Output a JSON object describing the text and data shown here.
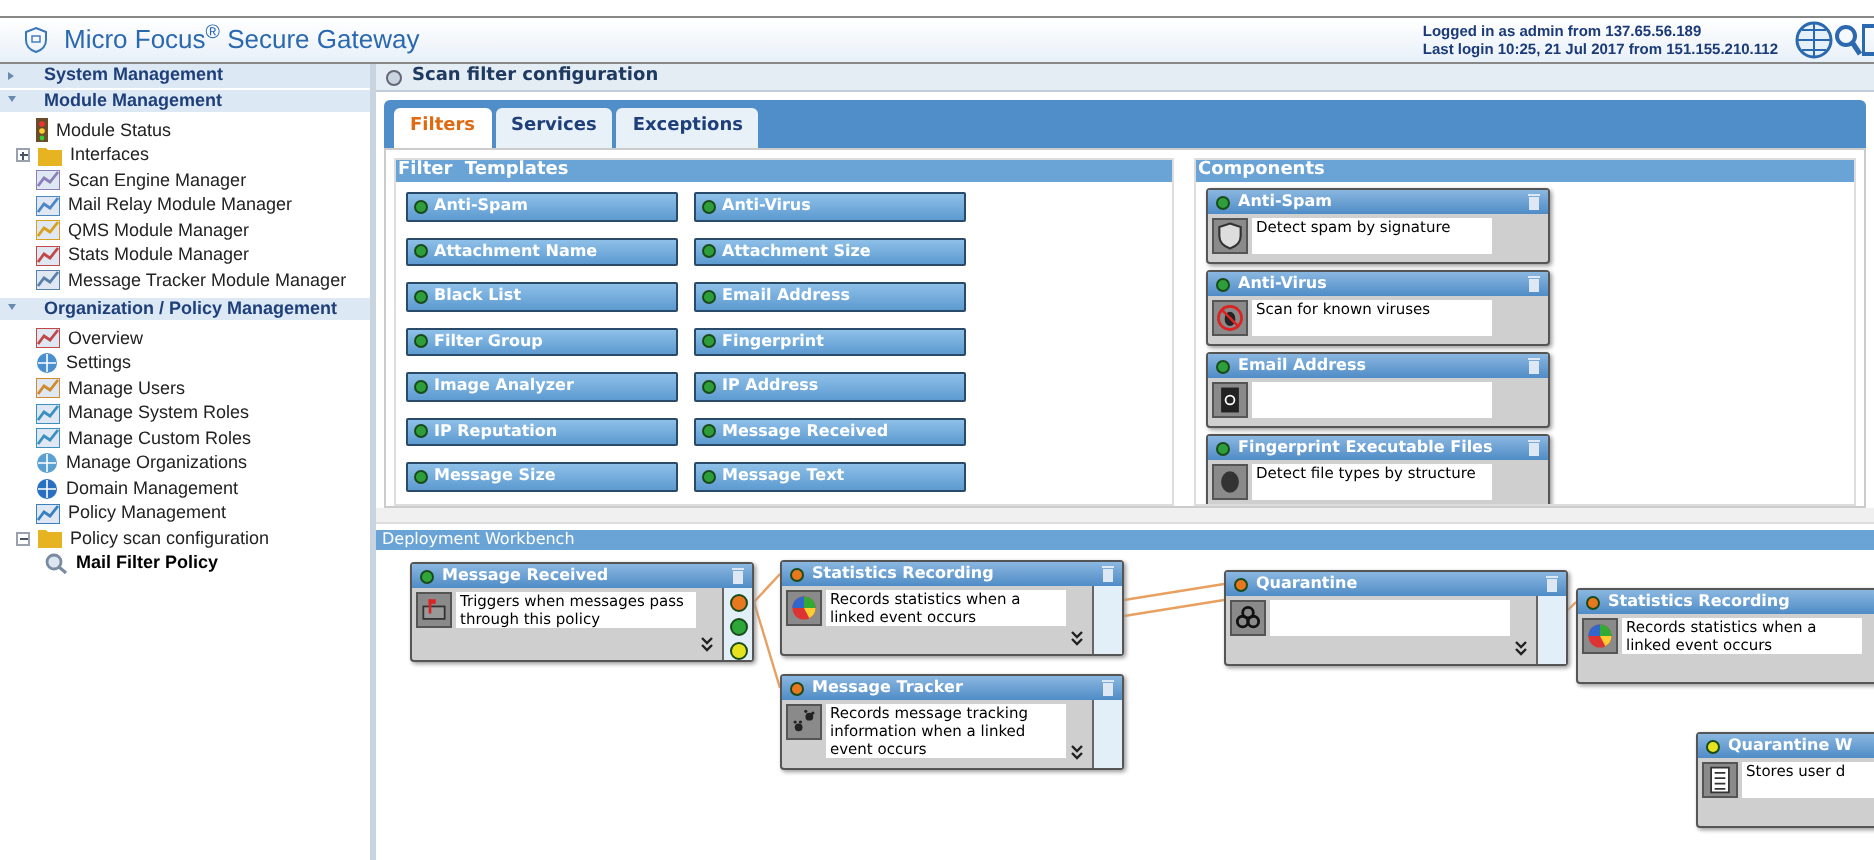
{
  "header": {
    "title": "Micro Focus$^{®}$ Secure Gateway",
    "login_line": "Logged in as admin from 137.65.56.189",
    "last_login_line": "Last login 10:25, 21 Jul 2017 from 151.155.210.112"
  },
  "sidebar": {
    "sections": [
      {
        "title": "System Management",
        "expanded": false
      },
      {
        "title": "Module Management",
        "expanded": true,
        "items": [
          {
            "label": "Module Status",
            "selected": false
          },
          {
            "label": "Interfaces",
            "selected": false,
            "expanded": false
          },
          {
            "label": "Scan Engine Manager",
            "selected": false
          },
          {
            "label": "Mail Relay Module Manager",
            "selected": false
          },
          {
            "label": "QMS Module Manager",
            "selected": false
          },
          {
            "label": "Stats Module Manager",
            "selected": false
          },
          {
            "label": "Message Tracker Module Manager",
            "selected": false
          }
        ]
      },
      {
        "title": "Organization / Policy Management",
        "expanded": true,
        "items": [
          {
            "label": "Overview",
            "selected": false
          },
          {
            "label": "Settings",
            "selected": false
          },
          {
            "label": "Manage Users",
            "selected": false
          },
          {
            "label": "Manage System Roles",
            "selected": false
          },
          {
            "label": "Manage Custom Roles",
            "selected": false
          },
          {
            "label": "Manage Organizations",
            "selected": false
          },
          {
            "label": "Domain Management",
            "selected": false
          },
          {
            "label": "Policy Management",
            "selected": false
          },
          {
            "label": "Policy scan configuration",
            "selected": false,
            "expanded": true,
            "children": [
              {
                "label": "Mail Filter Policy",
                "selected": true
              }
            ]
          }
        ]
      }
    ]
  },
  "page_title": "Scan filter configuration",
  "tabs": [
    {
      "label": "Filters",
      "selected": true
    },
    {
      "label": "Services",
      "selected": false
    },
    {
      "label": "Exceptions",
      "selected": false
    }
  ],
  "filter_templates": {
    "title": "Filter  Templates",
    "items": [
      {
        "label": "Anti-Spam",
        "color": "#2e9e3a"
      },
      {
        "label": "Anti-Virus",
        "color": "#2e9e3a"
      },
      {
        "label": "Attachment Name",
        "color": "#2e9e3a"
      },
      {
        "label": "Attachment Size",
        "color": "#2e9e3a"
      },
      {
        "label": "Black List",
        "color": "#2e9e3a"
      },
      {
        "label": "Email Address",
        "color": "#2e9e3a"
      },
      {
        "label": "Filter Group",
        "color": "#2e9e3a"
      },
      {
        "label": "Fingerprint",
        "color": "#2e9e3a"
      },
      {
        "label": "Image Analyzer",
        "color": "#2e9e3a"
      },
      {
        "label": "IP Address",
        "color": "#2e9e3a"
      },
      {
        "label": "IP Reputation",
        "color": "#2e9e3a"
      },
      {
        "label": "Message Received",
        "color": "#2e9e3a"
      },
      {
        "label": "Message Size",
        "color": "#2e9e3a"
      },
      {
        "label": "Message Text",
        "color": "#2e9e3a"
      }
    ]
  },
  "components": {
    "title": "Components",
    "items": [
      {
        "title": "Anti-Spam",
        "description": "Detect spam by signature",
        "color": "#2e9e3a"
      },
      {
        "title": "Anti-Virus",
        "description": "Scan for known viruses",
        "color": "#2e9e3a"
      },
      {
        "title": "Email Address",
        "color": "#2e9e3a"
      },
      {
        "title": "Fingerprint Executable Files",
        "description": "Detect file types by structure",
        "color": "#2e9e3a"
      }
    ]
  },
  "workbench": {
    "title": "Deployment Workbench",
    "nodes": [
      {
        "title": "Message Received",
        "description": "Triggers when messages pass through this policy",
        "color": "#2ea63a",
        "ports": [
          {
            "color": "#e8781e"
          },
          {
            "color": "#2ea63a"
          },
          {
            "color": "#e6e21e"
          }
        ]
      },
      {
        "title": "Statistics Recording",
        "description": "Records statistics when a linked event occurs",
        "color": "#e8781e"
      },
      {
        "title": "Message Tracker",
        "description": "Records message tracking information when a linked event occurs",
        "color": "#e8781e"
      },
      {
        "title": "Quarantine",
        "color": "#e8781e"
      },
      {
        "title": "Statistics Recording",
        "description": "Records statistics when a linked event occurs",
        "color": "#e8781e"
      },
      {
        "title": "Quarantine W",
        "description": "Stores user d",
        "color": "#e6e21e"
      }
    ]
  }
}
